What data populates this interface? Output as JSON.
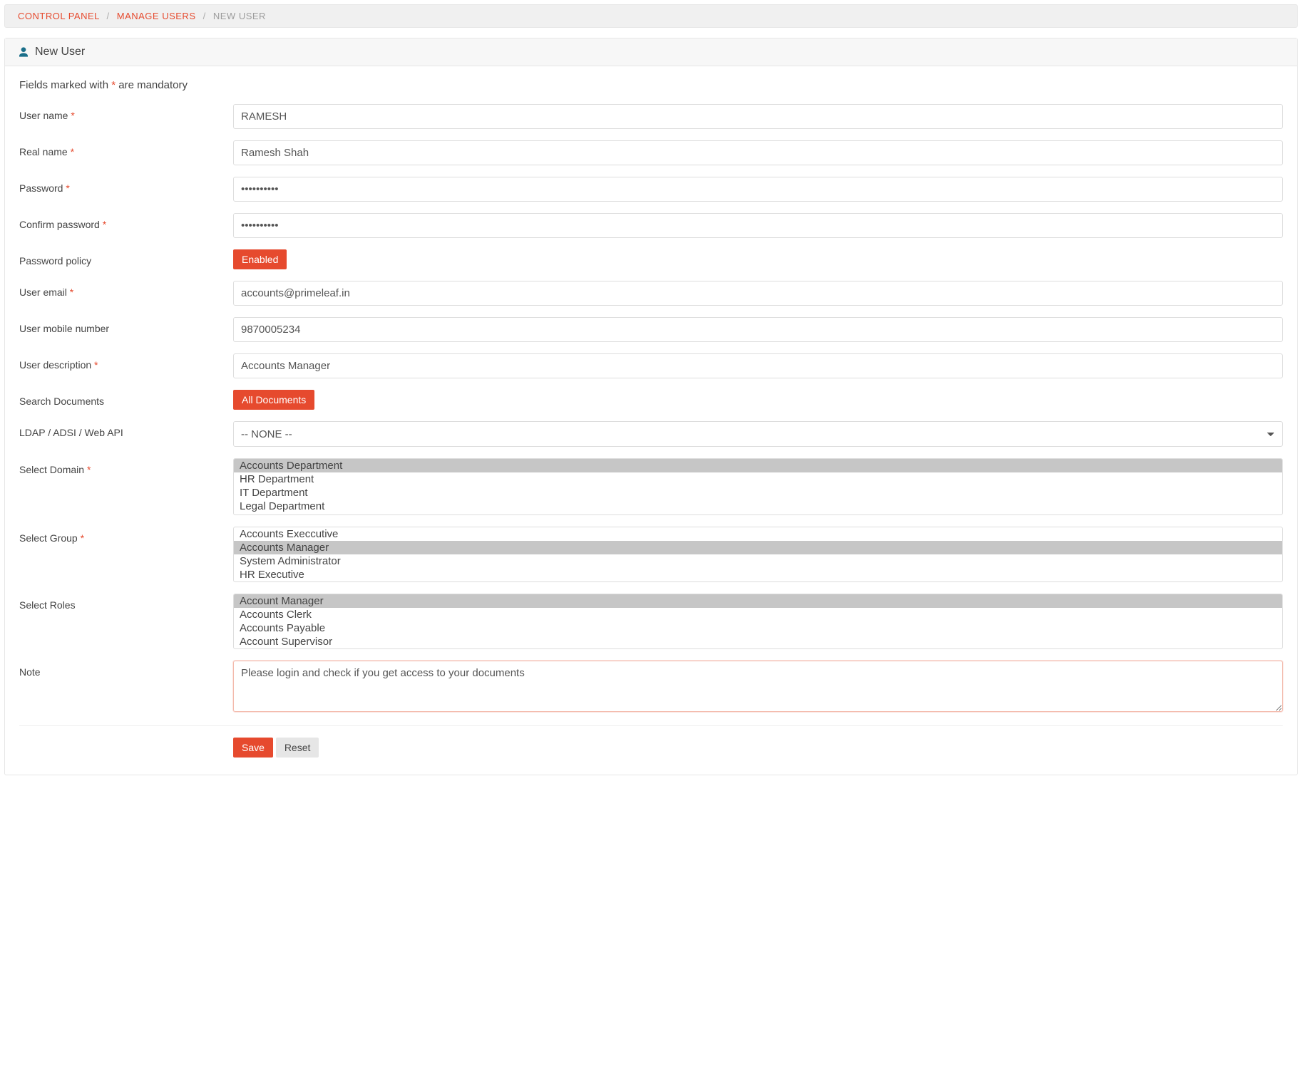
{
  "breadcrumb": {
    "items": [
      {
        "label": "CONTROL PANEL",
        "link": true
      },
      {
        "label": "MANAGE USERS",
        "link": true
      },
      {
        "label": "NEW USER",
        "link": false
      }
    ]
  },
  "panel": {
    "title": "New User",
    "mandatory_note_prefix": "Fields marked with ",
    "mandatory_note_suffix": " are mandatory"
  },
  "labels": {
    "user_name": "User name",
    "real_name": "Real name",
    "password": "Password",
    "confirm_password": "Confirm password",
    "password_policy": "Password policy",
    "user_email": "User email",
    "user_mobile": "User mobile number",
    "user_description": "User description",
    "search_documents": "Search Documents",
    "ldap": "LDAP / ADSI / Web API",
    "select_domain": "Select Domain",
    "select_group": "Select Group",
    "select_roles": "Select Roles",
    "note": "Note"
  },
  "required": {
    "user_name": true,
    "real_name": true,
    "password": true,
    "confirm_password": true,
    "password_policy": false,
    "user_email": true,
    "user_mobile": false,
    "user_description": true,
    "search_documents": false,
    "ldap": false,
    "select_domain": true,
    "select_group": true,
    "select_roles": false,
    "note": false
  },
  "values": {
    "user_name": "RAMESH",
    "real_name": "Ramesh Shah",
    "password": "••••••••••",
    "confirm_password": "••••••••••",
    "password_policy_button": "Enabled",
    "user_email": "accounts@primeleaf.in",
    "user_mobile": "9870005234",
    "user_description": "Accounts Manager",
    "search_documents_button": "All Documents",
    "ldap_selected": "-- NONE --",
    "note": "Please login and check if you get access to your documents"
  },
  "domains": [
    {
      "label": "Accounts Department",
      "selected": true
    },
    {
      "label": "HR Department",
      "selected": false
    },
    {
      "label": "IT Department",
      "selected": false
    },
    {
      "label": "Legal Department",
      "selected": false
    }
  ],
  "groups": [
    {
      "label": "Accounts Execcutive",
      "selected": false
    },
    {
      "label": "Accounts Manager",
      "selected": true
    },
    {
      "label": "System Administrator",
      "selected": false
    },
    {
      "label": "HR Executive",
      "selected": false
    }
  ],
  "roles": [
    {
      "label": "Account Manager",
      "selected": true
    },
    {
      "label": "Accounts Clerk",
      "selected": false
    },
    {
      "label": "Accounts Payable",
      "selected": false
    },
    {
      "label": "Account Supervisor",
      "selected": false
    }
  ],
  "buttons": {
    "save": "Save",
    "reset": "Reset"
  }
}
